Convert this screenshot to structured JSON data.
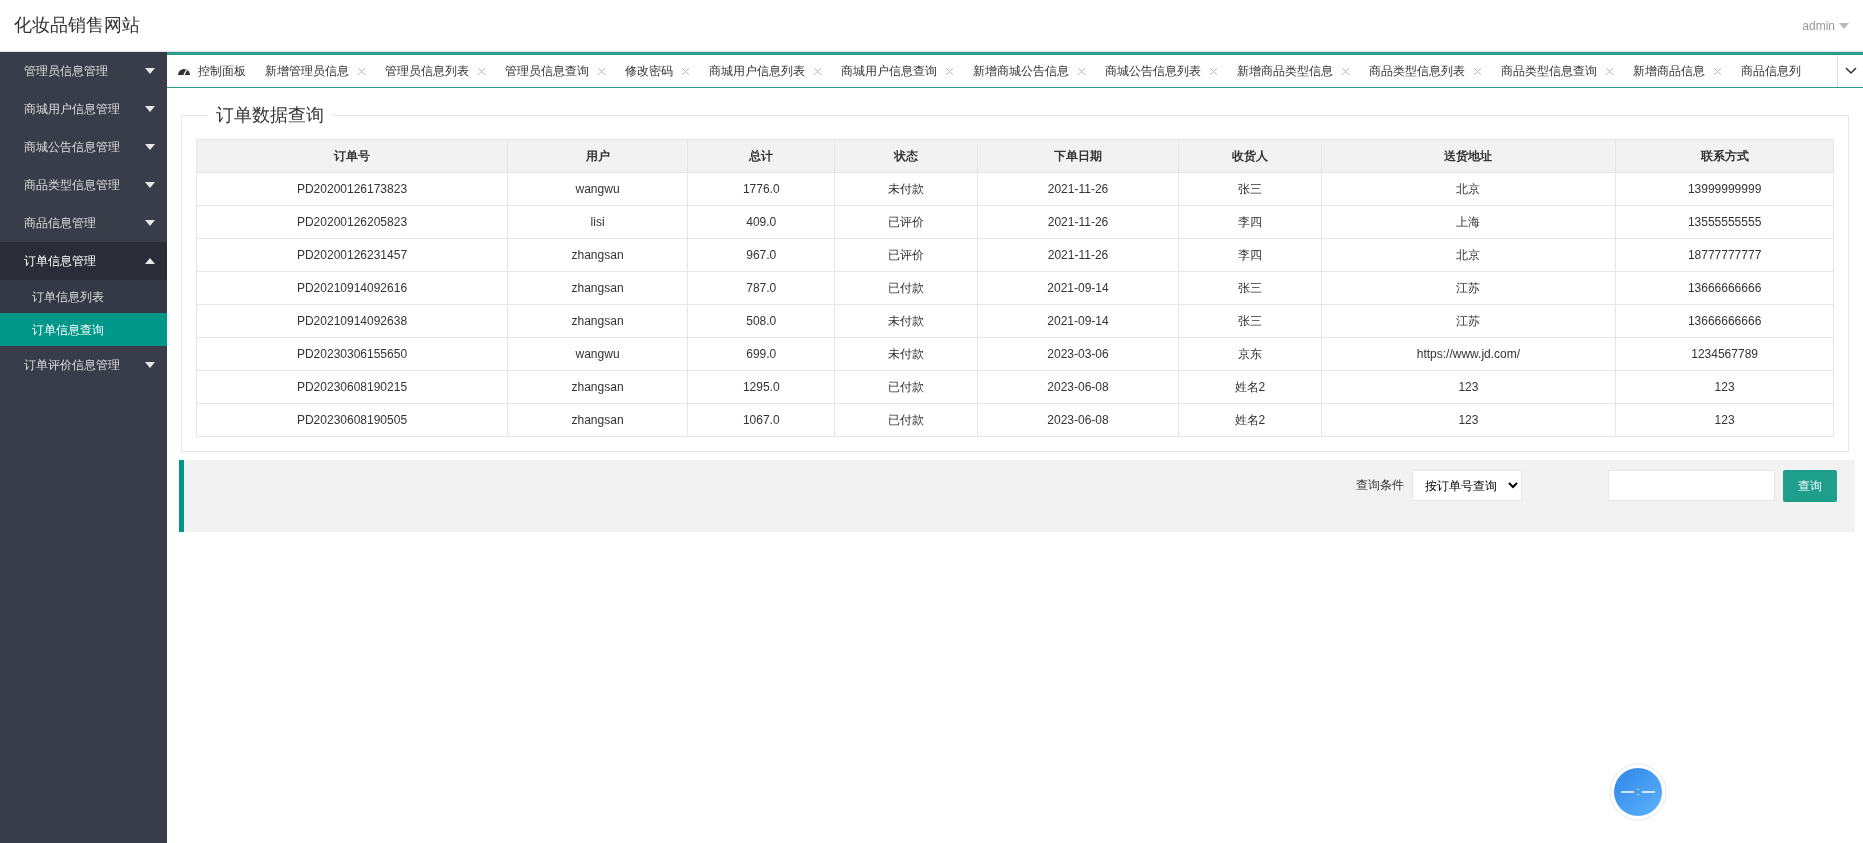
{
  "header": {
    "title": "化妆品销售网站",
    "user": "admin"
  },
  "sidebar": [
    {
      "label": "管理员信息管理",
      "expanded": false
    },
    {
      "label": "商城用户信息管理",
      "expanded": false
    },
    {
      "label": "商城公告信息管理",
      "expanded": false
    },
    {
      "label": "商品类型信息管理",
      "expanded": false
    },
    {
      "label": "商品信息管理",
      "expanded": false
    },
    {
      "label": "订单信息管理",
      "expanded": true,
      "children": [
        {
          "label": "订单信息列表",
          "selected": false
        },
        {
          "label": "订单信息查询",
          "selected": true
        }
      ]
    },
    {
      "label": "订单评价信息管理",
      "expanded": false
    }
  ],
  "tabs": [
    {
      "label": "控制面板",
      "kind": "home"
    },
    {
      "label": "新增管理员信息",
      "kind": "closable"
    },
    {
      "label": "管理员信息列表",
      "kind": "closable"
    },
    {
      "label": "管理员信息查询",
      "kind": "closable"
    },
    {
      "label": "修改密码",
      "kind": "closable"
    },
    {
      "label": "商城用户信息列表",
      "kind": "closable"
    },
    {
      "label": "商城用户信息查询",
      "kind": "closable"
    },
    {
      "label": "新增商城公告信息",
      "kind": "closable"
    },
    {
      "label": "商城公告信息列表",
      "kind": "closable"
    },
    {
      "label": "新增商品类型信息",
      "kind": "closable"
    },
    {
      "label": "商品类型信息列表",
      "kind": "closable"
    },
    {
      "label": "商品类型信息查询",
      "kind": "closable"
    },
    {
      "label": "新增商品信息",
      "kind": "closable"
    },
    {
      "label": "商品信息列",
      "kind": "cut"
    }
  ],
  "panel": {
    "title": "订单数据查询",
    "table": {
      "columns": [
        "订单号",
        "用户",
        "总计",
        "状态",
        "下单日期",
        "收货人",
        "送货地址",
        "联系方式"
      ],
      "rows": [
        [
          "PD20200126173823",
          "wangwu",
          "1776.0",
          "未付款",
          "2021-11-26",
          "张三",
          "北京",
          "13999999999"
        ],
        [
          "PD20200126205823",
          "lisi",
          "409.0",
          "已评价",
          "2021-11-26",
          "李四",
          "上海",
          "13555555555"
        ],
        [
          "PD20200126231457",
          "zhangsan",
          "967.0",
          "已评价",
          "2021-11-26",
          "李四",
          "北京",
          "18777777777"
        ],
        [
          "PD20210914092616",
          "zhangsan",
          "787.0",
          "已付款",
          "2021-09-14",
          "张三",
          "江苏",
          "13666666666"
        ],
        [
          "PD20210914092638",
          "zhangsan",
          "508.0",
          "未付款",
          "2021-09-14",
          "张三",
          "江苏",
          "13666666666"
        ],
        [
          "PD20230306155650",
          "wangwu",
          "699.0",
          "未付款",
          "2023-03-06",
          "京东",
          "https://www.jd.com/",
          "1234567789"
        ],
        [
          "PD20230608190215",
          "zhangsan",
          "1295.0",
          "已付款",
          "2023-06-08",
          "姓名2",
          "123",
          "123"
        ],
        [
          "PD20230608190505",
          "zhangsan",
          "1067.0",
          "已付款",
          "2023-06-08",
          "姓名2",
          "123",
          "123"
        ]
      ]
    }
  },
  "search": {
    "label": "查询条件",
    "select": "按订单号查询",
    "button": "查询"
  }
}
